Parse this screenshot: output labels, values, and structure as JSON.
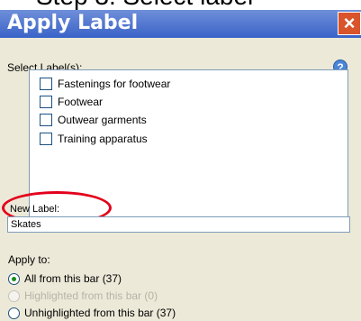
{
  "top_fragment": "Step 3: Select label",
  "window": {
    "title": "Apply Label",
    "close_symbol": "×"
  },
  "select_labels": {
    "heading": "Select Label(s):",
    "help_symbol": "?",
    "items": [
      {
        "label": "Fastenings for footwear",
        "checked": false
      },
      {
        "label": "Footwear",
        "checked": false
      },
      {
        "label": "Outwear garments",
        "checked": false
      },
      {
        "label": "Training apparatus",
        "checked": false
      }
    ]
  },
  "new_label": {
    "heading": "New Label:",
    "value": "Skates",
    "highlight_color": "#e3001b"
  },
  "apply_to": {
    "heading": "Apply to:",
    "options": [
      {
        "label": "All from this bar (37)",
        "selected": true,
        "disabled": false
      },
      {
        "label": "Highlighted from this bar (0)",
        "selected": false,
        "disabled": true
      },
      {
        "label": "Unhighlighted from this bar (37)",
        "selected": false,
        "disabled": false
      }
    ]
  },
  "colors": {
    "titlebar": "#3a63c8",
    "close_button": "#d9532b",
    "dialog_bg": "#ece9d8"
  }
}
